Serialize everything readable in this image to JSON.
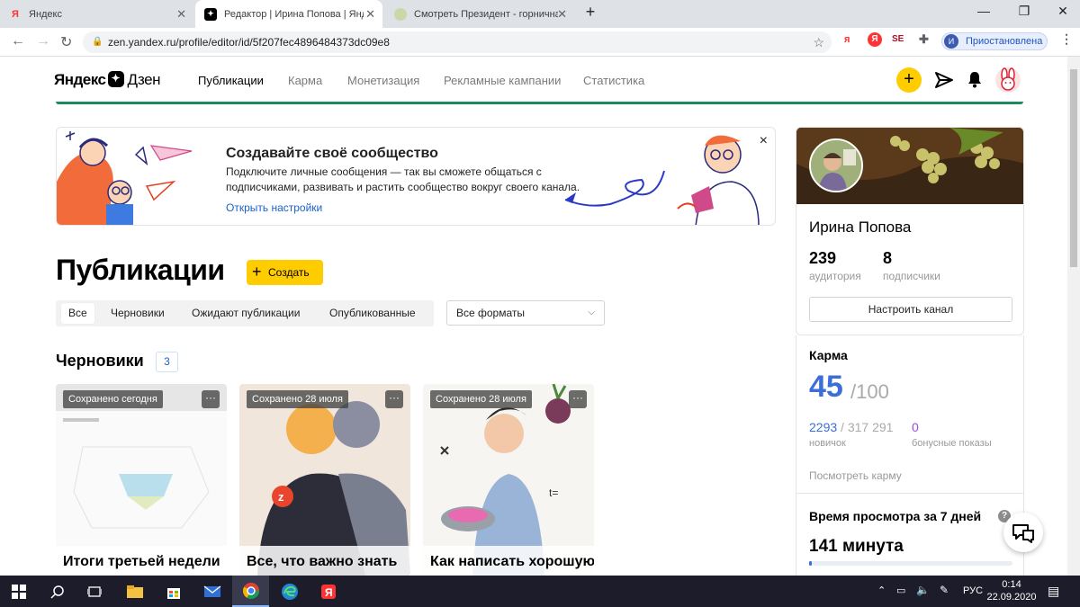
{
  "browser": {
    "tabs": [
      {
        "title": "Яндекс",
        "favicon": "yandex-icon"
      },
      {
        "title": "Редактор | Ирина Попова | Яндекс",
        "favicon": "zen-icon"
      },
      {
        "title": "Смотреть Президент - горничная",
        "favicon": "film-icon"
      }
    ],
    "url": "zen.yandex.ru/profile/editor/id/5f207fec4896484373dc09e8",
    "profile_status": "Приостановлена",
    "profile_initial": "И"
  },
  "zen": {
    "logo_text": "Яндекс",
    "logo_zen": "Дзен",
    "nav": [
      "Публикации",
      "Карма",
      "Монетизация",
      "Рекламные кампании",
      "Статистика"
    ],
    "plus_label": "+"
  },
  "promo": {
    "title": "Создавайте своё сообщество",
    "description": "Подключите личные сообщения — так вы сможете общаться с подписчиками, развивать и растить сообщество вокруг своего канала.",
    "link": "Открыть настройки",
    "close": "×"
  },
  "publications": {
    "title": "Публикации",
    "create_label": "Создать",
    "filters": [
      "Все",
      "Черновики",
      "Ожидают публикации",
      "Опубликованные"
    ],
    "format_select": "Все форматы",
    "drafts_title": "Черновики",
    "drafts_count": "3",
    "cards": [
      {
        "saved": "Сохранено сегодня",
        "title": "Итоги третьей недели"
      },
      {
        "saved": "Сохранено 28 июля",
        "title": "Все, что важно знать"
      },
      {
        "saved": "Сохранено 28 июля",
        "title": "Как написать хорошую"
      }
    ],
    "card_menu": "···"
  },
  "channel": {
    "name": "Ирина Попова",
    "audience_value": "239",
    "audience_label": "аудитория",
    "subscribers_value": "8",
    "subscribers_label": "подписчики",
    "setup_button": "Настроить канал"
  },
  "karma": {
    "title": "Карма",
    "value": "45",
    "max": "/100",
    "novice_value": "2293",
    "novice_total": " / 317 291",
    "novice_label": "новичок",
    "bonus_value": "0",
    "bonus_label": "бонусные показы",
    "see_link": "Посмотреть карму"
  },
  "watch_time": {
    "title": "Время просмотра за 7 дней",
    "help": "?",
    "value": "141 минута",
    "progress_fraction": 0.0141
  },
  "taskbar": {
    "lang": "РУС",
    "time": "0:14",
    "date": "22.09.2020"
  },
  "colors": {
    "accent_yellow": "#ffcc00",
    "link_blue": "#1a62c9",
    "karma_blue": "#3c6dd8",
    "bonus_purple": "#9b4de0",
    "green_line": "#1f8a5f"
  }
}
